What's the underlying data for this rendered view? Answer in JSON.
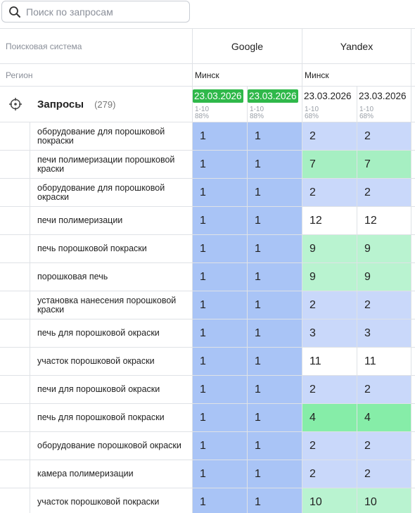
{
  "search": {
    "placeholder": "Поиск по запросам",
    "value": ""
  },
  "header": {
    "engine_label": "Поисковая система",
    "region_label": "Регион",
    "queries_title": "Запросы",
    "queries_count": "(279)",
    "engines": [
      {
        "name": "Google",
        "region": "Минск"
      },
      {
        "name": "Yandex",
        "region": "Минск"
      }
    ],
    "columns": [
      {
        "date": "23.03.2026",
        "range": "1-10",
        "percent": "88%",
        "highlight": true
      },
      {
        "date": "23.03.2026",
        "range": "1-10",
        "percent": "88%",
        "highlight": true
      },
      {
        "date": "23.03.2026",
        "range": "1-10",
        "percent": "68%",
        "highlight": false
      },
      {
        "date": "23.03.2026",
        "range": "1-10",
        "percent": "68%",
        "highlight": false
      }
    ]
  },
  "colors": {
    "top": "#a9c4f6",
    "good": "#c9d8fa",
    "green_light": "#b9f3d0",
    "green_mid": "#a6efc2",
    "green_strong": "#86eda8",
    "none": "#ffffff"
  },
  "rows": [
    {
      "query": "оборудование для порошковой покраски",
      "positions": [
        "1",
        "1",
        "2",
        "2"
      ],
      "tones": [
        "top",
        "top",
        "good",
        "good"
      ]
    },
    {
      "query": "печи полимеризации порошковой краски",
      "positions": [
        "1",
        "1",
        "7",
        "7"
      ],
      "tones": [
        "top",
        "top",
        "green_mid",
        "green_mid"
      ]
    },
    {
      "query": "оборудование для порошковой окраски",
      "positions": [
        "1",
        "1",
        "2",
        "2"
      ],
      "tones": [
        "top",
        "top",
        "good",
        "good"
      ]
    },
    {
      "query": "печи полимеризации",
      "positions": [
        "1",
        "1",
        "12",
        "12"
      ],
      "tones": [
        "top",
        "top",
        "none",
        "none"
      ]
    },
    {
      "query": "печь порошковой покраски",
      "positions": [
        "1",
        "1",
        "9",
        "9"
      ],
      "tones": [
        "top",
        "top",
        "green_light",
        "green_light"
      ]
    },
    {
      "query": "порошковая печь",
      "positions": [
        "1",
        "1",
        "9",
        "9"
      ],
      "tones": [
        "top",
        "top",
        "green_light",
        "green_light"
      ]
    },
    {
      "query": "установка нанесения порошковой краски",
      "positions": [
        "1",
        "1",
        "2",
        "2"
      ],
      "tones": [
        "top",
        "top",
        "good",
        "good"
      ]
    },
    {
      "query": "печь для порошковой окраски",
      "positions": [
        "1",
        "1",
        "3",
        "3"
      ],
      "tones": [
        "top",
        "top",
        "good",
        "good"
      ]
    },
    {
      "query": "участок порошковой окраски",
      "positions": [
        "1",
        "1",
        "11",
        "11"
      ],
      "tones": [
        "top",
        "top",
        "none",
        "none"
      ]
    },
    {
      "query": "печи для порошковой окраски",
      "positions": [
        "1",
        "1",
        "2",
        "2"
      ],
      "tones": [
        "top",
        "top",
        "good",
        "good"
      ]
    },
    {
      "query": "печь для порошковой покраски",
      "positions": [
        "1",
        "1",
        "4",
        "4"
      ],
      "tones": [
        "top",
        "top",
        "green_strong",
        "green_strong"
      ]
    },
    {
      "query": "оборудование порошковой окраски",
      "positions": [
        "1",
        "1",
        "2",
        "2"
      ],
      "tones": [
        "top",
        "top",
        "good",
        "good"
      ]
    },
    {
      "query": "камера полимеризации",
      "positions": [
        "1",
        "1",
        "2",
        "2"
      ],
      "tones": [
        "top",
        "top",
        "good",
        "good"
      ]
    },
    {
      "query": "участок порошковой покраски",
      "positions": [
        "1",
        "1",
        "10",
        "10"
      ],
      "tones": [
        "top",
        "top",
        "green_light",
        "green_light"
      ]
    }
  ]
}
